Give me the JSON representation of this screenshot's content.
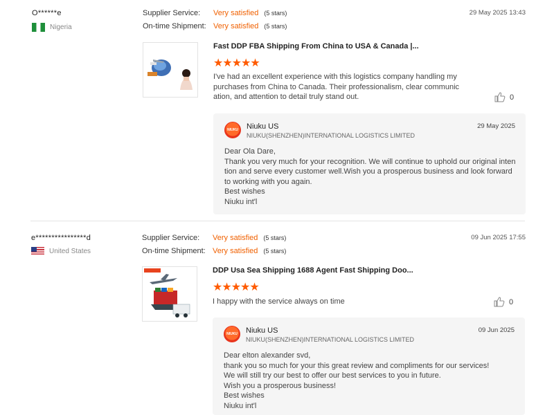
{
  "reviews": [
    {
      "user": "O******e",
      "country": "Nigeria",
      "supplier_label": "Supplier Service:",
      "supplier_value": "Very satisfied",
      "supplier_stars": "(5 stars)",
      "shipment_label": "On-time Shipment:",
      "shipment_value": "Very satisfied",
      "shipment_stars": "(5 stars)",
      "date": "29 May 2025 13:43",
      "product_title": "Fast DDP FBA Shipping From China to USA & Canada |...",
      "rating": 5,
      "stars": "★★★★★",
      "text": "I've had an excellent experience with this logistics company handling my purchases from China to Canada. Their professionalism, clear communic ation, and attention to detail truly stand out.",
      "likes": "0",
      "reply": {
        "name": "Niuku US",
        "company": "NIUKU(SHENZHEN)INTERNATIONAL LOGISTICS LIMITED",
        "date": "29 May 2025",
        "lines": [
          "Dear Ola Dare,",
          "Thank you very much for your recognition. We will continue to uphold our original inten",
          "tion and serve every customer well.Wish you a prosperous business and look forward",
          "to working with you again.",
          "Best wishes",
          "Niuku int'l"
        ]
      }
    },
    {
      "user": "e****************d",
      "country": "United States",
      "supplier_label": "Supplier Service:",
      "supplier_value": "Very satisfied",
      "supplier_stars": "(5 stars)",
      "shipment_label": "On-time Shipment:",
      "shipment_value": "Very satisfied",
      "shipment_stars": "(5 stars)",
      "date": "09 Jun 2025 17:55",
      "product_title": "DDP Usa Sea Shipping 1688 Agent Fast Shipping Doo...",
      "rating": 5,
      "stars": "★★★★★",
      "text": "I happy with the service always on time",
      "likes": "0",
      "reply": {
        "name": "Niuku US",
        "company": "NIUKU(SHENZHEN)INTERNATIONAL LOGISTICS LIMITED",
        "date": "09 Jun 2025",
        "lines": [
          "Dear elton alexander svd,",
          "thank you so much for your this great review and compliments for our services!",
          "We will still try our best to offer our best services to you in future.",
          "Wish you a prosperous business!",
          "Best wishes",
          "Niuku int'l"
        ]
      }
    }
  ],
  "colors": {
    "accent": "#f06000",
    "star": "#ff5b00",
    "reply_bg": "#f5f5f5"
  },
  "icons": {
    "like": "thumbs-up-icon",
    "logo": "niuku-logo-icon"
  }
}
